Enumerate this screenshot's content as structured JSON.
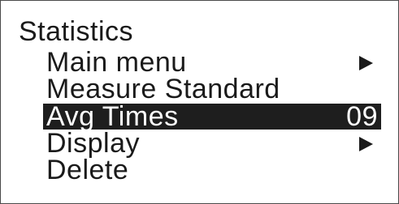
{
  "screen": {
    "title": "Statistics"
  },
  "menu": {
    "items": [
      {
        "label": "Main menu",
        "value": "",
        "has_submenu": true
      },
      {
        "label": "Measure Standard",
        "value": "",
        "has_submenu": false
      },
      {
        "label": "Avg Times",
        "value": "09",
        "has_submenu": false,
        "selected": true
      },
      {
        "label": "Display",
        "value": "",
        "has_submenu": true
      },
      {
        "label": "Delete",
        "value": "",
        "has_submenu": false
      }
    ]
  },
  "colors": {
    "background": "#ffffff",
    "text": "#1a1a1a",
    "selection_background": "#1e1e1e",
    "selection_text": "#ffffff",
    "border": "#4a4a4a"
  },
  "icons": {
    "submenu": "right-triangle-icon"
  }
}
